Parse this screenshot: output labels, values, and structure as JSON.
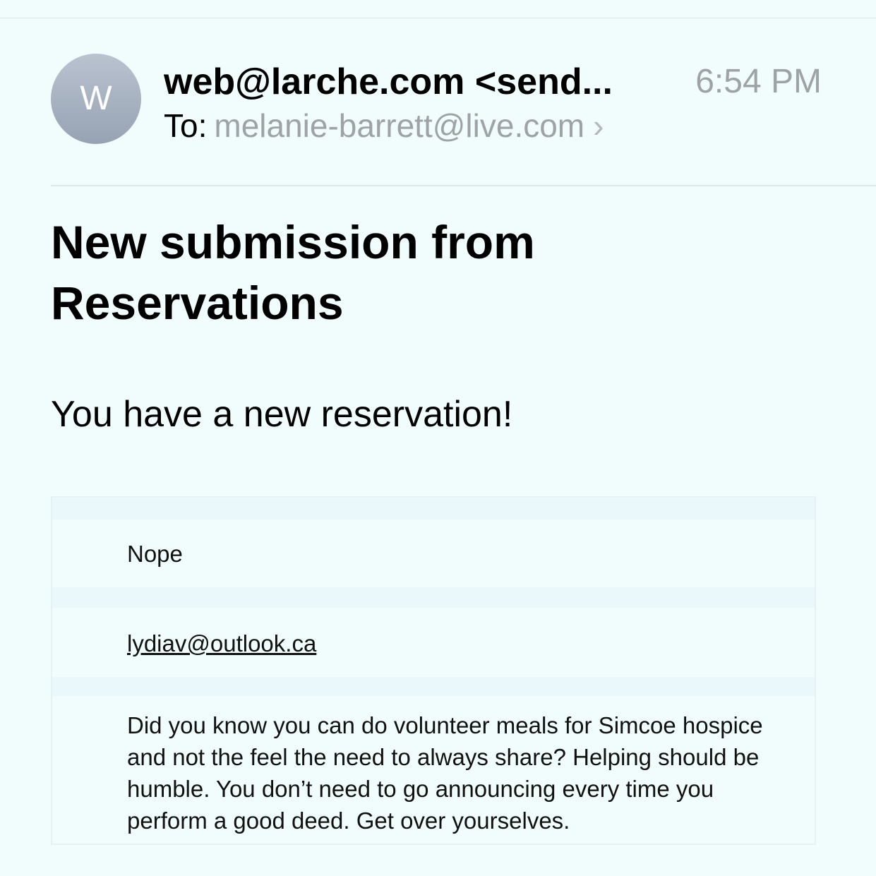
{
  "email": {
    "avatar_initial": "W",
    "sender": "web@larche.com <send...",
    "time": "6:54 PM",
    "to_label": "To:",
    "to_address": "melanie-barrett@live.com",
    "subject": "New submission from Reservations",
    "intro": "You have a new reservation!",
    "fields": [
      {
        "value": "Nope"
      },
      {
        "value": "lydiav@outlook.ca"
      },
      {
        "value": "Did you know you can do volunteer meals for Simcoe hospice and not the feel the need to always share? Helping should be humble. You don’t need to go announcing every time you perform a good deed. Get over yourselves."
      }
    ]
  },
  "icons": {
    "recipient_details": "chevron-right-icon"
  }
}
